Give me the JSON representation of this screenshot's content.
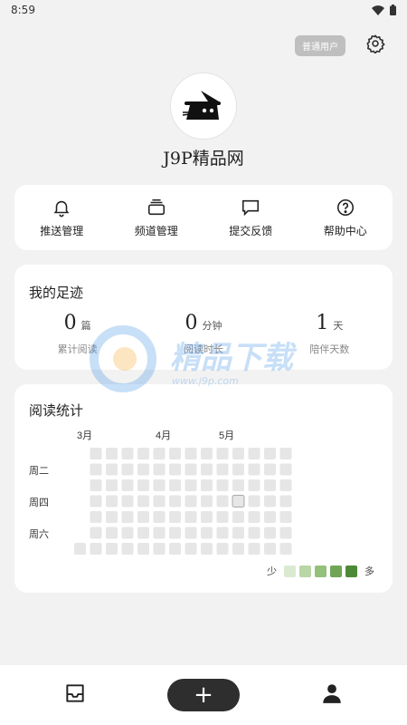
{
  "status_bar": {
    "time": "8:59"
  },
  "header": {
    "user_badge": "普通用户"
  },
  "profile": {
    "site_name": "J9P精品网"
  },
  "quick_actions": [
    {
      "label": "推送管理",
      "icon": "bell-icon"
    },
    {
      "label": "频道管理",
      "icon": "stack-icon"
    },
    {
      "label": "提交反馈",
      "icon": "chat-icon"
    },
    {
      "label": "帮助中心",
      "icon": "help-icon"
    }
  ],
  "footprint": {
    "title": "我的足迹",
    "stats": [
      {
        "value": "0",
        "unit": "篇",
        "label": "累计阅读"
      },
      {
        "value": "0",
        "unit": "分钟",
        "label": "阅读时长"
      },
      {
        "value": "1",
        "unit": "天",
        "label": "陪伴天数"
      }
    ]
  },
  "reading_stats": {
    "title": "阅读统计",
    "months": [
      "3月",
      "4月",
      "5月"
    ],
    "weekdays": [
      "周二",
      "周四",
      "周六"
    ],
    "legend_less": "少",
    "legend_more": "多",
    "legend_colors": [
      "#d9ead1",
      "#b8d6a6",
      "#93c17b",
      "#6fa656",
      "#4d8a37"
    ],
    "cell_color": "#e6e6e6",
    "weeks": 14
  },
  "watermark": {
    "text": "精品下载",
    "sub": "www.j9p.com"
  },
  "bottom_nav": {
    "add_label": "+"
  }
}
